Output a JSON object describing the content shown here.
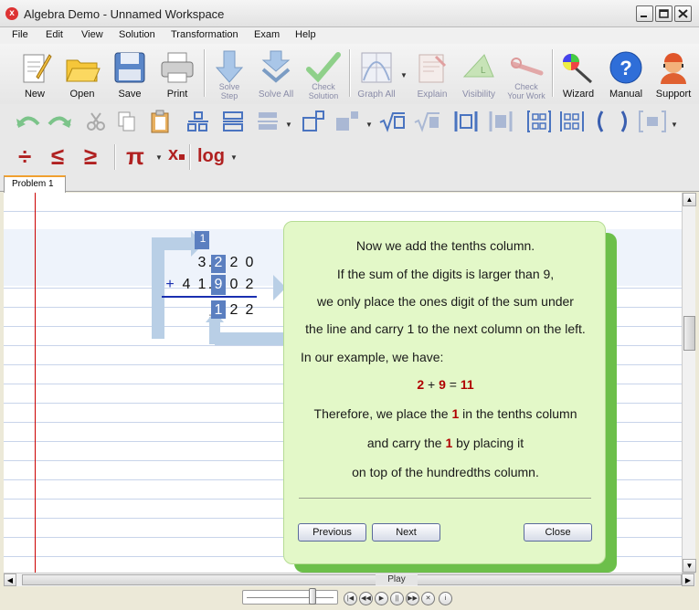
{
  "window": {
    "title": "Algebra Demo - Unnamed Workspace"
  },
  "menu": [
    "File",
    "Edit",
    "View",
    "Solution",
    "Transformation",
    "Exam",
    "Help"
  ],
  "toolbar": {
    "new": "New",
    "open": "Open",
    "save": "Save",
    "print": "Print",
    "solve_step": "Solve\nStep",
    "solve_all": "Solve All",
    "check_solution": "Check\nSolution",
    "graph_all": "Graph All",
    "explain": "Explain",
    "visibility": "Visibility",
    "check_work": "Check\nYour Work",
    "wizard": "Wizard",
    "manual": "Manual",
    "support": "Support"
  },
  "format_toolbar": {
    "pi": "π",
    "subscript": "x",
    "log": "log",
    "divide": "÷",
    "le": "≤",
    "ge": "≥"
  },
  "tabs": [
    "Problem 1"
  ],
  "arithmetic": {
    "carry": "1",
    "row1": [
      "3",
      ".",
      "2",
      "2",
      "0"
    ],
    "row2": [
      "+",
      "4",
      "1",
      ".",
      "9",
      "0",
      "2"
    ],
    "result": [
      ".",
      "1",
      "2",
      "2"
    ]
  },
  "explanation": {
    "line1": "Now we add the tenths column.",
    "line2": "If the sum of the digits is larger than 9,",
    "line3": "we only place the ones digit of the sum under",
    "line4_a": "the line and carry ",
    "line4_b": "1",
    "line4_c": " to the next column on the left.",
    "line5": "In our example, we have:",
    "eq_a": "2",
    "eq_op": " + ",
    "eq_b": "9",
    "eq_eq": " = ",
    "eq_c": "11",
    "line7_a": "Therefore, we place the ",
    "line7_b": "1",
    "line7_c": " in the tenths column",
    "line8_a": "and carry the ",
    "line8_b": "1",
    "line8_c": " by placing it",
    "line9": "on top of the hundredths column.",
    "previous": "Previous",
    "next": "Next",
    "close": "Close"
  },
  "playback": {
    "label": "Play"
  },
  "colors": {
    "accent_red": "#b00000",
    "balloon": "#e3f8c8",
    "balloon_shadow": "#6cbf4a",
    "highlight": "#5b7fc0"
  }
}
